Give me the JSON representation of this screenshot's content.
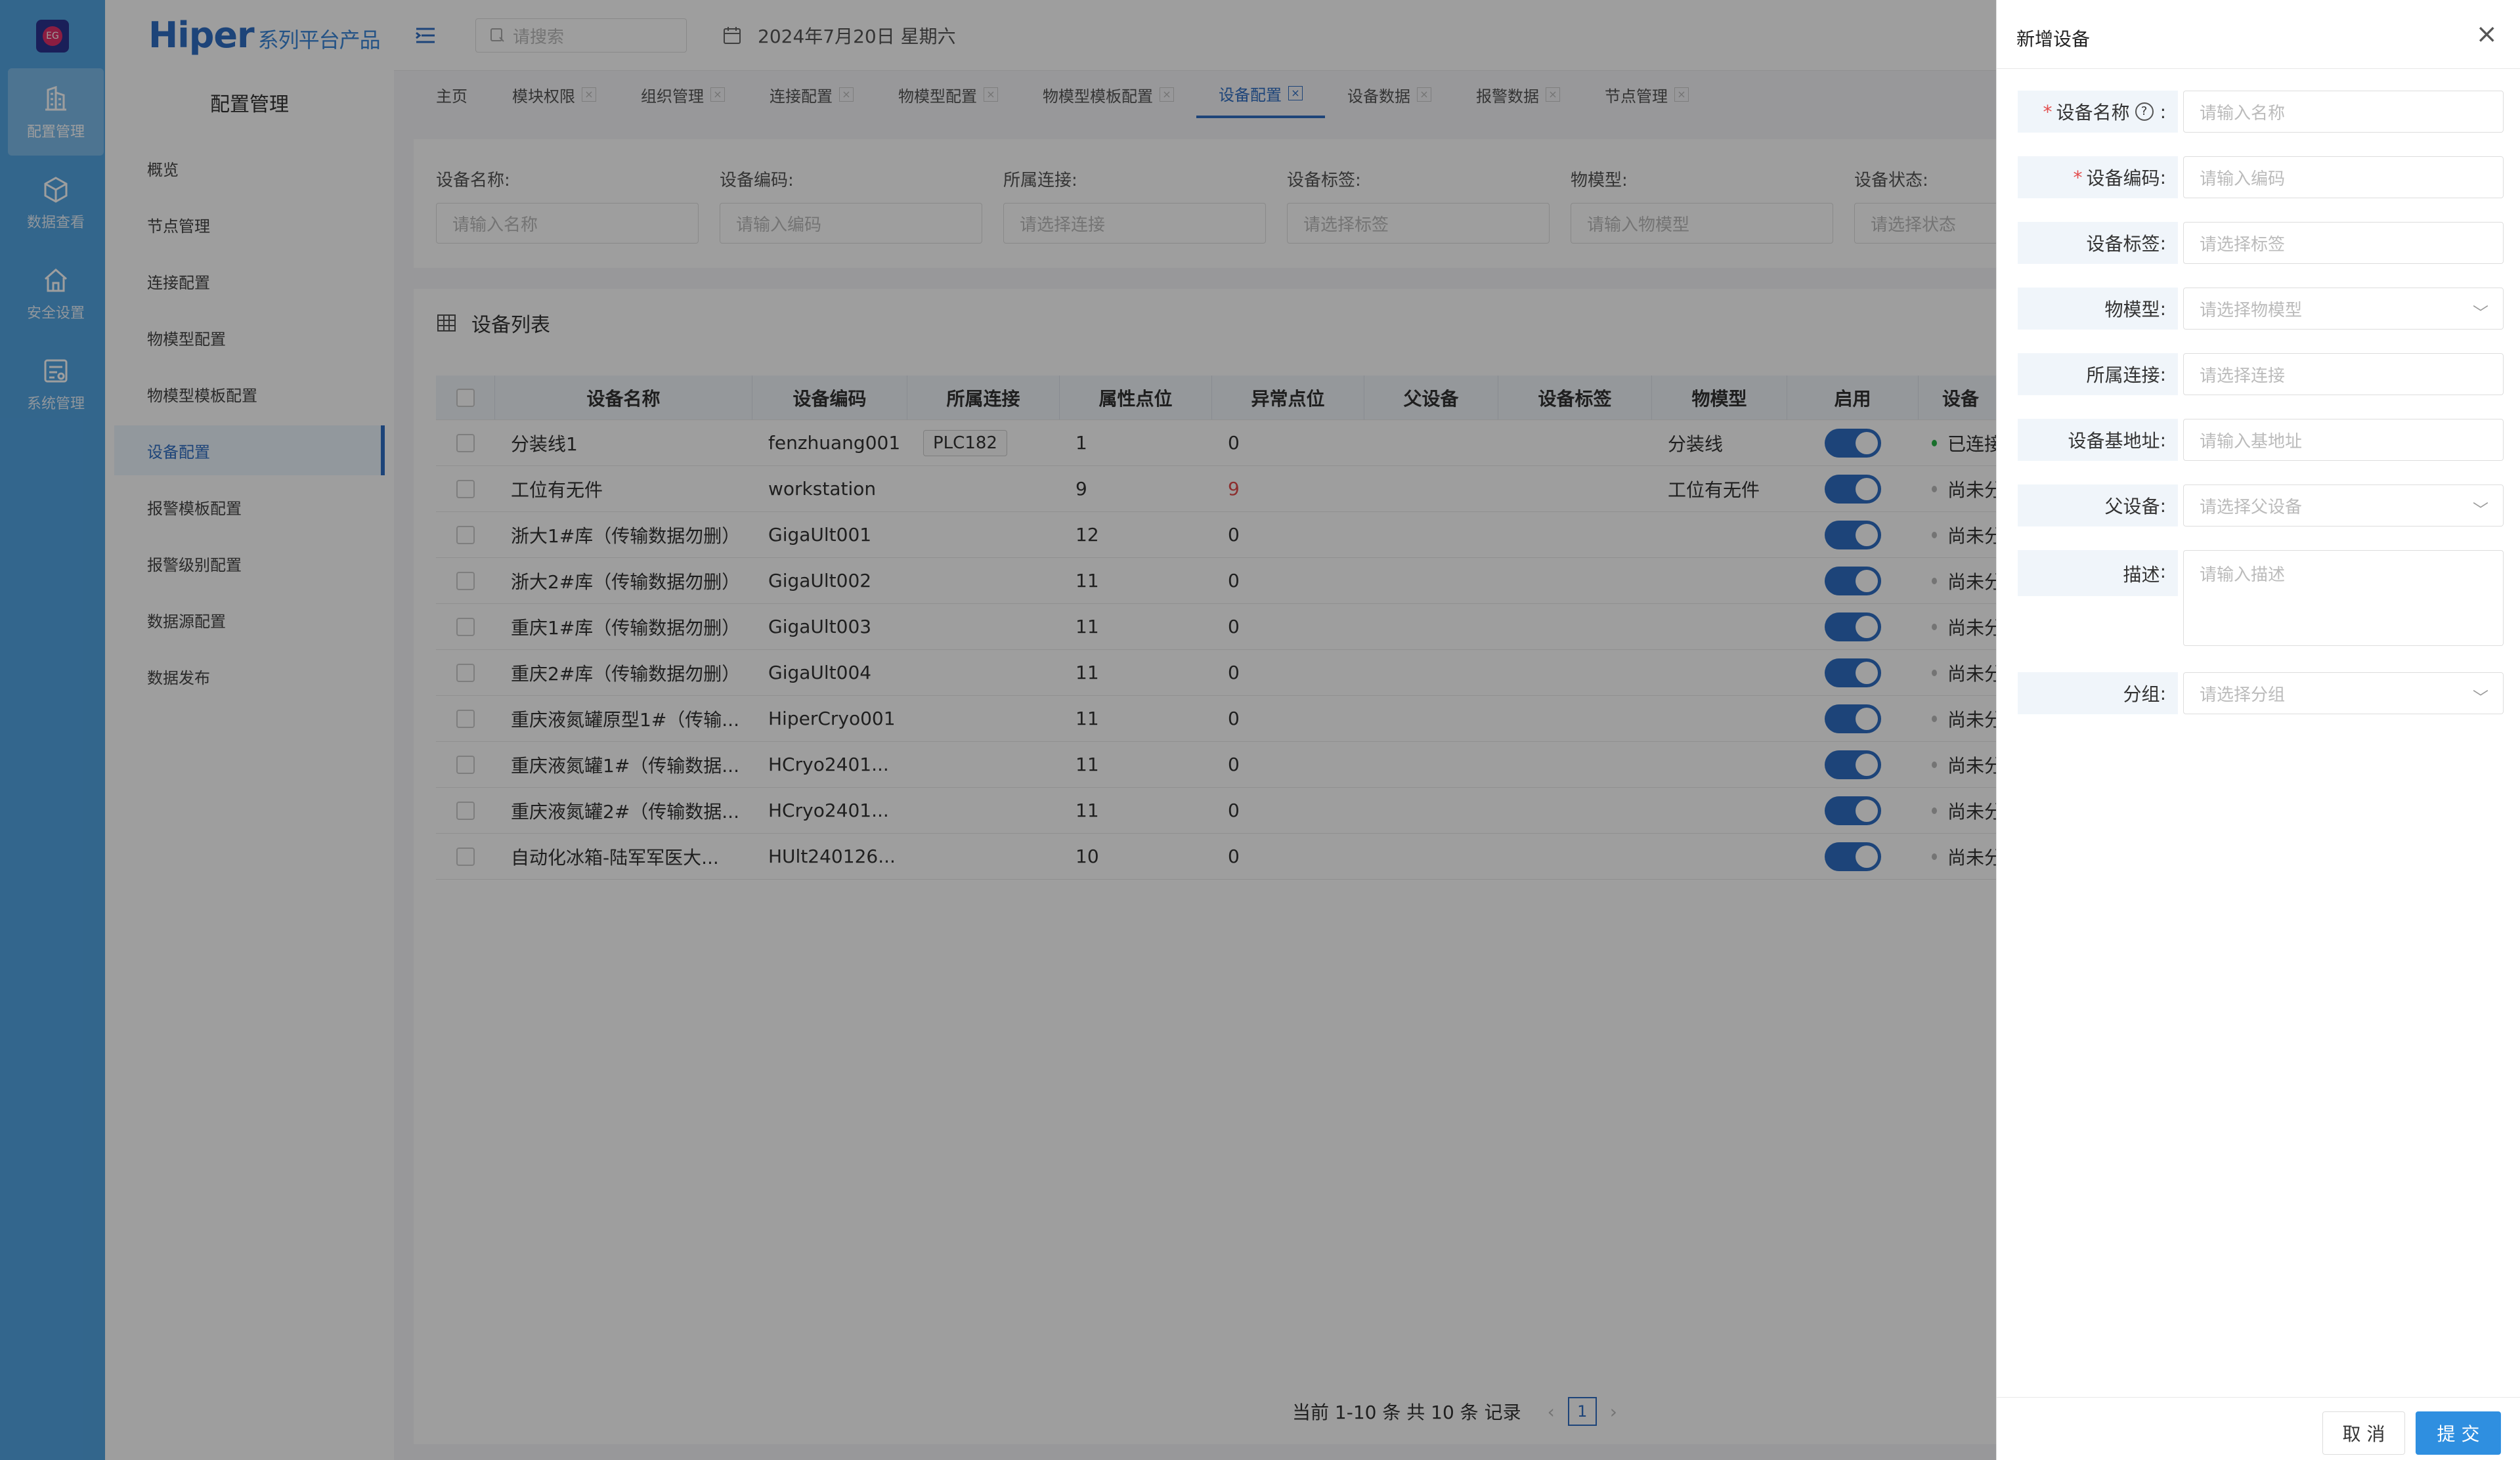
{
  "rail": {
    "logo": "EG",
    "items": [
      {
        "label": "配置管理",
        "icon": "building-icon",
        "active": true
      },
      {
        "label": "数据查看",
        "icon": "cube-icon",
        "active": false
      },
      {
        "label": "安全设置",
        "icon": "house-shield-icon",
        "active": false
      },
      {
        "label": "系统管理",
        "icon": "settings-panel-icon",
        "active": false
      }
    ]
  },
  "brand": {
    "name": "Hiper",
    "suffix": "系列平台产品"
  },
  "subnav": {
    "title": "配置管理",
    "items": [
      "概览",
      "节点管理",
      "连接配置",
      "物模型配置",
      "物模型模板配置",
      "设备配置",
      "报警模板配置",
      "报警级别配置",
      "数据源配置",
      "数据发布"
    ],
    "active_index": 5
  },
  "topbar": {
    "search_placeholder": "请搜索",
    "date": "2024年7月20日 星期六"
  },
  "tabs": [
    "主页",
    "模块权限",
    "组织管理",
    "连接配置",
    "物模型配置",
    "物模型模板配置",
    "设备配置",
    "设备数据",
    "报警数据",
    "节点管理"
  ],
  "tabs_active_index": 6,
  "filters": [
    {
      "label": "设备名称:",
      "placeholder": "请输入名称"
    },
    {
      "label": "设备编码:",
      "placeholder": "请输入编码"
    },
    {
      "label": "所属连接:",
      "placeholder": "请选择连接"
    },
    {
      "label": "设备标签:",
      "placeholder": "请选择标签"
    },
    {
      "label": "物模型:",
      "placeholder": "请输入物模型"
    },
    {
      "label": "设备状态:",
      "placeholder": "请选择状态"
    }
  ],
  "table": {
    "title": "设备列表",
    "columns": [
      "设备名称",
      "设备编码",
      "所属连接",
      "属性点位",
      "异常点位",
      "父设备",
      "设备标签",
      "物模型",
      "启用",
      "设备"
    ],
    "rows": [
      {
        "name": "分装线1",
        "code": "fenzhuang001",
        "conn": "PLC182",
        "attr": "1",
        "abn": "0",
        "abn_red": false,
        "parent": "",
        "tag": "",
        "model": "分装线",
        "status": "已连接",
        "status_color": "#28b446"
      },
      {
        "name": "工位有无件",
        "code": "workstation",
        "conn": "",
        "attr": "9",
        "abn": "9",
        "abn_red": true,
        "parent": "",
        "tag": "",
        "model": "工位有无件",
        "status": "尚未分",
        "status_color": "#bbbbbb"
      },
      {
        "name": "浙大1#库（传输数据勿删）",
        "code": "GigaUlt001",
        "conn": "",
        "attr": "12",
        "abn": "0",
        "abn_red": false,
        "parent": "",
        "tag": "",
        "model": "",
        "status": "尚未分",
        "status_color": "#bbbbbb"
      },
      {
        "name": "浙大2#库（传输数据勿删）",
        "code": "GigaUlt002",
        "conn": "",
        "attr": "11",
        "abn": "0",
        "abn_red": false,
        "parent": "",
        "tag": "",
        "model": "",
        "status": "尚未分",
        "status_color": "#bbbbbb"
      },
      {
        "name": "重庆1#库（传输数据勿删）",
        "code": "GigaUlt003",
        "conn": "",
        "attr": "11",
        "abn": "0",
        "abn_red": false,
        "parent": "",
        "tag": "",
        "model": "",
        "status": "尚未分",
        "status_color": "#bbbbbb"
      },
      {
        "name": "重庆2#库（传输数据勿删）",
        "code": "GigaUlt004",
        "conn": "",
        "attr": "11",
        "abn": "0",
        "abn_red": false,
        "parent": "",
        "tag": "",
        "model": "",
        "status": "尚未分",
        "status_color": "#bbbbbb"
      },
      {
        "name": "重庆液氮罐原型1#（传输...",
        "code": "HiperCryo001",
        "conn": "",
        "attr": "11",
        "abn": "0",
        "abn_red": false,
        "parent": "",
        "tag": "",
        "model": "",
        "status": "尚未分",
        "status_color": "#bbbbbb"
      },
      {
        "name": "重庆液氮罐1#（传输数据...",
        "code": "HCryo2401...",
        "conn": "",
        "attr": "11",
        "abn": "0",
        "abn_red": false,
        "parent": "",
        "tag": "",
        "model": "",
        "status": "尚未分",
        "status_color": "#bbbbbb"
      },
      {
        "name": "重庆液氮罐2#（传输数据...",
        "code": "HCryo2401...",
        "conn": "",
        "attr": "11",
        "abn": "0",
        "abn_red": false,
        "parent": "",
        "tag": "",
        "model": "",
        "status": "尚未分",
        "status_color": "#bbbbbb"
      },
      {
        "name": "自动化冰箱-陆军军医大...",
        "code": "HUlt240126...",
        "conn": "",
        "attr": "10",
        "abn": "0",
        "abn_red": false,
        "parent": "",
        "tag": "",
        "model": "",
        "status": "尚未分",
        "status_color": "#bbbbbb"
      }
    ]
  },
  "pager": {
    "summary": "当前 1-10 条 共 10 条 记录",
    "page": "1",
    "prev": "‹",
    "next": "›"
  },
  "drawer": {
    "title": "新增设备",
    "close": "×",
    "fields": [
      {
        "label": "设备名称",
        "placeholder": "请输入名称",
        "required": true,
        "help": true,
        "select": false
      },
      {
        "label": "设备编码",
        "placeholder": "请输入编码",
        "required": true,
        "help": false,
        "select": false
      },
      {
        "label": "设备标签",
        "placeholder": "请选择标签",
        "required": false,
        "help": false,
        "select": false
      },
      {
        "label": "物模型",
        "placeholder": "请选择物模型",
        "required": false,
        "help": false,
        "select": true
      },
      {
        "label": "所属连接",
        "placeholder": "请选择连接",
        "required": false,
        "help": false,
        "select": false
      },
      {
        "label": "设备基地址",
        "placeholder": "请输入基地址",
        "required": false,
        "help": false,
        "select": false
      },
      {
        "label": "父设备",
        "placeholder": "请选择父设备",
        "required": false,
        "help": false,
        "select": true
      },
      {
        "label": "描述",
        "placeholder": "请输入描述",
        "required": false,
        "help": false,
        "select": false,
        "textarea": true
      },
      {
        "label": "分组",
        "placeholder": "请选择分组",
        "required": false,
        "help": false,
        "select": true
      }
    ],
    "cancel": "取 消",
    "submit": "提 交"
  },
  "colors": {
    "accent": "#2f6fc3",
    "rail": "#53a5e3",
    "toggle_on": "#2f6fc3",
    "required": "#e34d4d"
  }
}
